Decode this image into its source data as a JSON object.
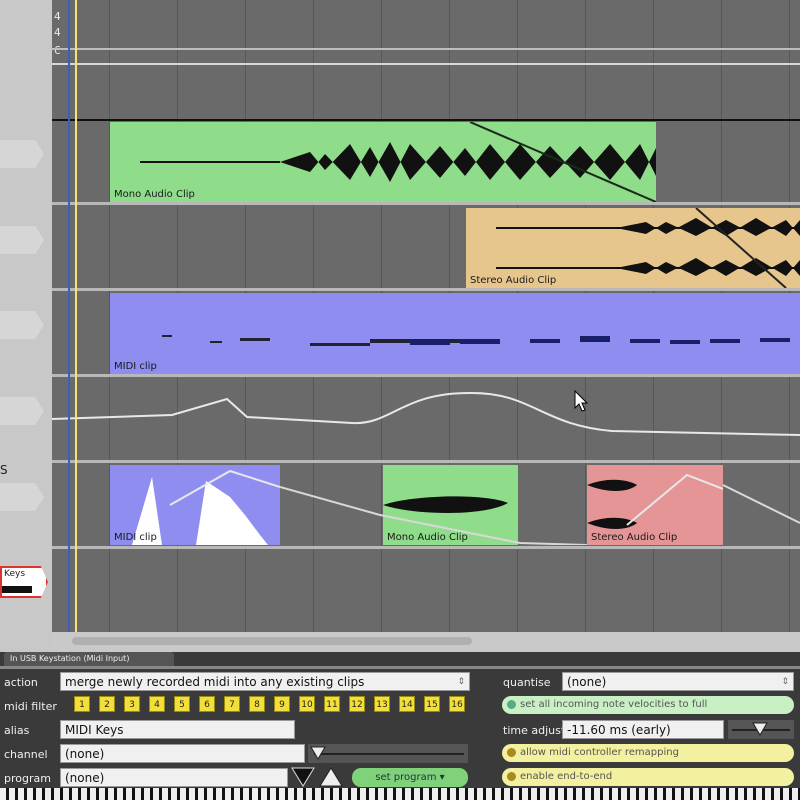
{
  "timesig": {
    "top": "4",
    "bottom": "4",
    "mark": "C"
  },
  "clips": {
    "mono1": {
      "label": "Mono Audio Clip",
      "color": "#8fdc8a"
    },
    "stereo1": {
      "label": "Stereo Audio Clip",
      "color": "#e6c68c"
    },
    "midi1": {
      "label": "MIDI clip",
      "color": "#8f8ef0"
    },
    "midi2": {
      "label": "MIDI clip",
      "color": "#8f8ef0"
    },
    "mono2": {
      "label": "Mono Audio Clip",
      "color": "#8fdc8a"
    },
    "stereo2": {
      "label": "Stereo Audio Clip",
      "color": "#e59595"
    }
  },
  "tracks": {
    "keys_label": "Keys",
    "side_letter": "S"
  },
  "panel": {
    "device_tab": "In USB Keystation (Midi Input)",
    "action": {
      "label": "action",
      "value": "merge newly recorded midi into any existing clips"
    },
    "midi_filter": {
      "label": "midi filter",
      "buttons": [
        "1",
        "2",
        "3",
        "4",
        "5",
        "6",
        "7",
        "8",
        "9",
        "10",
        "11",
        "12",
        "13",
        "14",
        "15",
        "16"
      ]
    },
    "alias": {
      "label": "alias",
      "value": "MIDI Keys"
    },
    "channel": {
      "label": "channel",
      "value": "(none)"
    },
    "program": {
      "label": "program",
      "value": "(none)",
      "button": "set program"
    },
    "quantise": {
      "label": "quantise",
      "value": "(none)"
    },
    "velocity_option": "set all incoming note velocities to full",
    "time_adjust": {
      "label": "time adjust",
      "value": "-11.60 ms (early)"
    },
    "remap_option": "allow midi controller remapping",
    "end_option": "enable end-to-end"
  },
  "colors": {
    "accent_yellow": "#f2df3a",
    "playhead": "#f5e27a",
    "cursor_line": "#3b5fbf"
  }
}
